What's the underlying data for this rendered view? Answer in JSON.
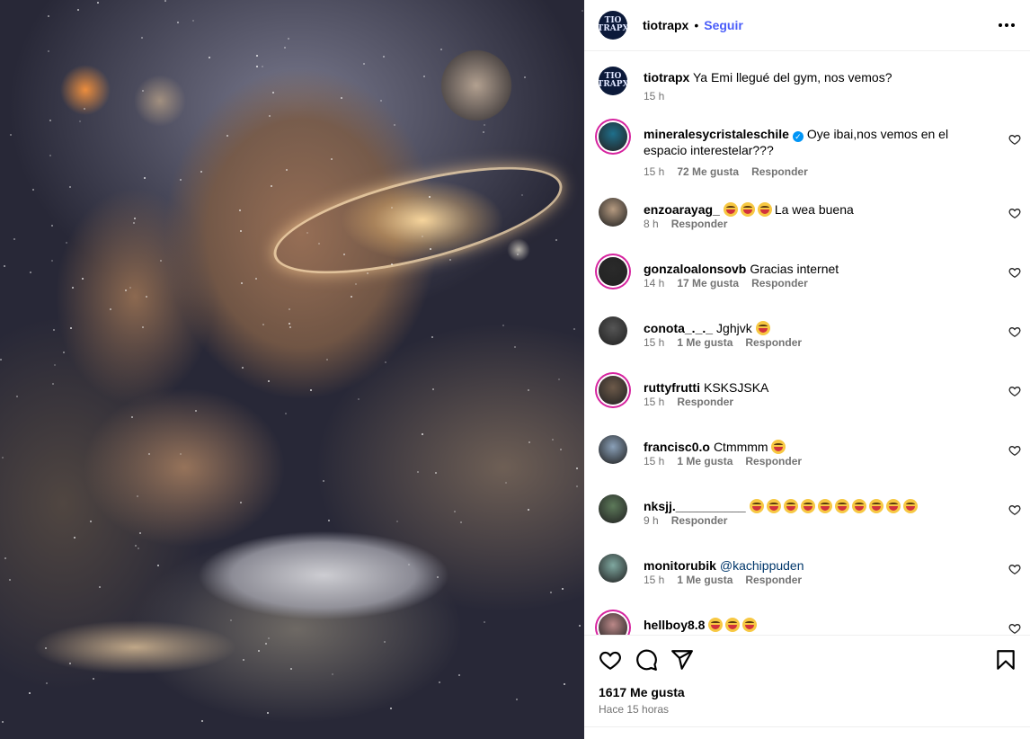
{
  "post": {
    "author": "tiotrapx",
    "author_logo_text": "TIO\nTRAPX",
    "separator": "•",
    "follow_label": "Seguir",
    "more_icon": "more-horizontal-icon",
    "image_alt": "Ilustración de un gigante musculoso en el espacio junto a un niño dormido en una cama"
  },
  "caption": {
    "user": "tiotrapx",
    "text": "Ya Emi llegué del gym, nos vemos?",
    "time": "15 h"
  },
  "comments": [
    {
      "user": "mineralesycristaleschile",
      "verified": true,
      "text": "Oye ibai,nos vemos en el espacio interestelar???",
      "emoji_count": 0,
      "time": "15 h",
      "likes": "72 Me gusta",
      "reply": "Responder",
      "avatar_color": "#1f6f8b"
    },
    {
      "user": "enzoarayag_",
      "verified": false,
      "text": "La wea buena",
      "emoji_count": 3,
      "emoji_first": true,
      "time": "8 h",
      "likes": "",
      "reply": "Responder",
      "avatar_color": "#b59a80"
    },
    {
      "user": "gonzaloalonsovb",
      "verified": false,
      "text": "Gracias internet",
      "emoji_count": 0,
      "time": "14 h",
      "likes": "17 Me gusta",
      "reply": "Responder",
      "avatar_color": "#2a2a2a"
    },
    {
      "user": "conota_._._",
      "verified": false,
      "text": "Jghjvk",
      "emoji_count": 1,
      "time": "15 h",
      "likes": "1 Me gusta",
      "reply": "Responder",
      "avatar_color": "#555"
    },
    {
      "user": "ruttyfrutti",
      "verified": false,
      "text": "KSKSJSKA",
      "emoji_count": 0,
      "time": "15 h",
      "likes": "",
      "reply": "Responder",
      "avatar_color": "#6d5a4a"
    },
    {
      "user": "francisc0.o",
      "verified": false,
      "text": "Ctmmmm",
      "emoji_count": 1,
      "time": "15 h",
      "likes": "1 Me gusta",
      "reply": "Responder",
      "avatar_color": "#8aa0b8"
    },
    {
      "user": "nksjj.__________",
      "verified": false,
      "text": "",
      "emoji_count": 10,
      "time": "9 h",
      "likes": "",
      "reply": "Responder",
      "avatar_color": "#5d7a5a"
    },
    {
      "user": "monitorubik",
      "verified": false,
      "text": "",
      "mention": "@kachippuden",
      "emoji_count": 0,
      "time": "15 h",
      "likes": "1 Me gusta",
      "reply": "Responder",
      "avatar_color": "#7fa8a0"
    },
    {
      "user": "hellboy8.8",
      "verified": false,
      "text": "",
      "emoji_count": 3,
      "time": "",
      "likes": "",
      "reply": "",
      "avatar_color": "#b88"
    }
  ],
  "actions": {
    "like_icon": "heart-icon",
    "comment_icon": "comment-icon",
    "share_icon": "share-icon",
    "save_icon": "bookmark-icon",
    "likes_count": "1617 Me gusta",
    "time": "Hace 15 horas"
  },
  "colors": {
    "follow": "#4a5df9",
    "meta_gray": "#737373",
    "story_ring": "#d6249f",
    "verified": "#0095f6"
  }
}
